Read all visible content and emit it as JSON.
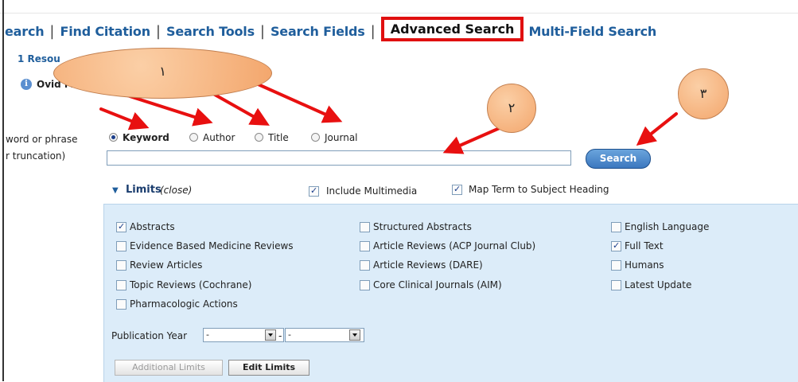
{
  "nav": {
    "items": [
      "earch",
      "Find Citation",
      "Search Tools",
      "Search Fields"
    ],
    "active": "Advanced Search",
    "after": "Multi-Field Search"
  },
  "resources": {
    "label": "1 Resou",
    "item": "Ovid M"
  },
  "search": {
    "label_line1": "word or phrase",
    "label_line2": "r truncation)",
    "options": [
      {
        "label": "Keyword",
        "selected": true
      },
      {
        "label": "Author",
        "selected": false
      },
      {
        "label": "Title",
        "selected": false
      },
      {
        "label": "Journal",
        "selected": false
      }
    ],
    "value": "",
    "button": "Search"
  },
  "limits": {
    "title": "Limits",
    "close": "(close)",
    "header_options": [
      {
        "label": "Include Multimedia",
        "checked": true
      },
      {
        "label": "Map Term to Subject Heading",
        "checked": true
      }
    ],
    "col1": [
      {
        "label": "Abstracts",
        "checked": true
      },
      {
        "label": "Evidence Based Medicine Reviews",
        "checked": false
      },
      {
        "label": "Review Articles",
        "checked": false
      },
      {
        "label": "Topic Reviews (Cochrane)",
        "checked": false
      },
      {
        "label": "Pharmacologic Actions",
        "checked": false
      }
    ],
    "col2": [
      {
        "label": "Structured Abstracts",
        "checked": false
      },
      {
        "label": "Article Reviews (ACP Journal Club)",
        "checked": false
      },
      {
        "label": "Article Reviews (DARE)",
        "checked": false
      },
      {
        "label": "Core Clinical Journals (AIM)",
        "checked": false
      }
    ],
    "col3": [
      {
        "label": "English Language",
        "checked": false
      },
      {
        "label": "Full Text",
        "checked": true
      },
      {
        "label": "Humans",
        "checked": false
      },
      {
        "label": "Latest Update",
        "checked": false
      }
    ],
    "pubyear": {
      "label": "Publication Year",
      "from": "-",
      "sep": "-",
      "to": "-"
    },
    "buttons": {
      "additional": "Additional Limits",
      "edit": "Edit Limits"
    }
  },
  "annotations": {
    "one": "١",
    "two": "٢",
    "three": "٣"
  },
  "colors": {
    "highlight": "#e01010",
    "arrow": "#e81010",
    "oval": "#f3a66c",
    "panel": "#dcecf9"
  }
}
